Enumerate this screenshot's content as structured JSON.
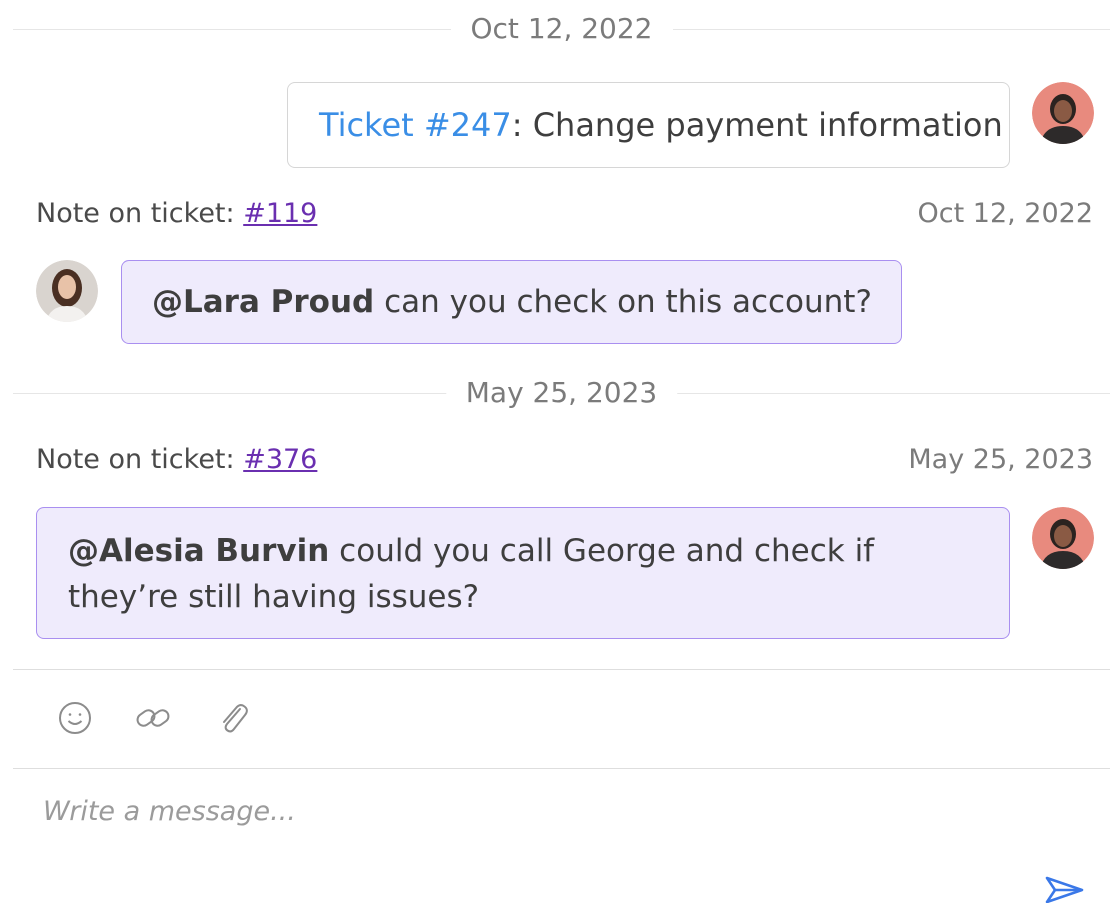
{
  "dividers": [
    {
      "label": "Oct 12, 2022"
    },
    {
      "label": "May 25, 2023"
    }
  ],
  "ticket_message": {
    "ticket_link": "Ticket #247",
    "text": ": Change payment information"
  },
  "notes": [
    {
      "header_prefix": "Note on ticket: ",
      "ticket_ref": "#119",
      "date": "Oct 12, 2022",
      "mention": "@Lara Proud",
      "text": " can you check on this account?"
    },
    {
      "header_prefix": "Note on ticket: ",
      "ticket_ref": "#376",
      "date": "May 25, 2023",
      "mention": "@Alesia Burvin",
      "text": " could you call George and check if they’re still having issues?"
    }
  ],
  "composer": {
    "placeholder": "Write a message...",
    "value": ""
  },
  "icons": {
    "emoji": "smiley-icon",
    "link": "link-icon",
    "attach": "paperclip-icon",
    "send": "send-icon"
  },
  "colors": {
    "ticket_link": "#3a8ee6",
    "ticket_ref": "#6a2fb0",
    "note_bg": "#efebfc",
    "note_border": "#a98ff0",
    "send_icon": "#3a78e8"
  }
}
